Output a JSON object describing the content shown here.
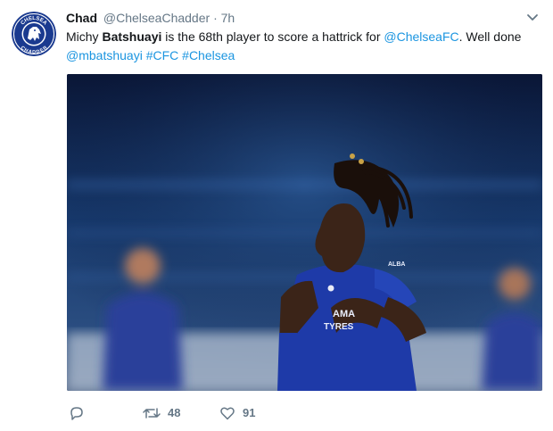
{
  "tweet": {
    "author": {
      "name": "Chad",
      "handle": "@ChelseaChadder",
      "separator": "·",
      "time": "7h",
      "avatar": {
        "text_top": "CHELSEA",
        "text_bottom": "CHADDER",
        "colors": {
          "primary": "#1a3a8f",
          "light": "#ffffff"
        }
      }
    },
    "menu_icon": "chevron-down-icon",
    "text_segments": [
      {
        "text": "Michy ",
        "style": "plain"
      },
      {
        "text": "Batshuayi",
        "style": "bold"
      },
      {
        "text": " is the 68th player to score a hattrick for ",
        "style": "plain"
      },
      {
        "text": "@ChelseaFC",
        "style": "link"
      },
      {
        "text": ". Well done ",
        "style": "plain"
      },
      {
        "text": "@mbatshuayi",
        "style": "link"
      },
      {
        "text": " ",
        "style": "plain"
      },
      {
        "text": "#CFC",
        "style": "link"
      },
      {
        "text": " ",
        "style": "plain"
      },
      {
        "text": "#Chelsea",
        "style": "link"
      }
    ],
    "media": {
      "kind": "photo",
      "shirt_text_1": "AMA",
      "shirt_text_2": "TYRES",
      "sleeve_text": "ALBA",
      "colors": {
        "kit": "#1e3aa8",
        "crowd": "#173a6e",
        "skin": "#3b2418"
      }
    },
    "actions": {
      "reply": {
        "icon": "reply-icon",
        "count": ""
      },
      "retweet": {
        "icon": "retweet-icon",
        "count": "48"
      },
      "like": {
        "icon": "heart-icon",
        "count": "91"
      }
    },
    "colors": {
      "link": "#1b95e0",
      "muted": "#657786",
      "text": "#14171a"
    }
  }
}
